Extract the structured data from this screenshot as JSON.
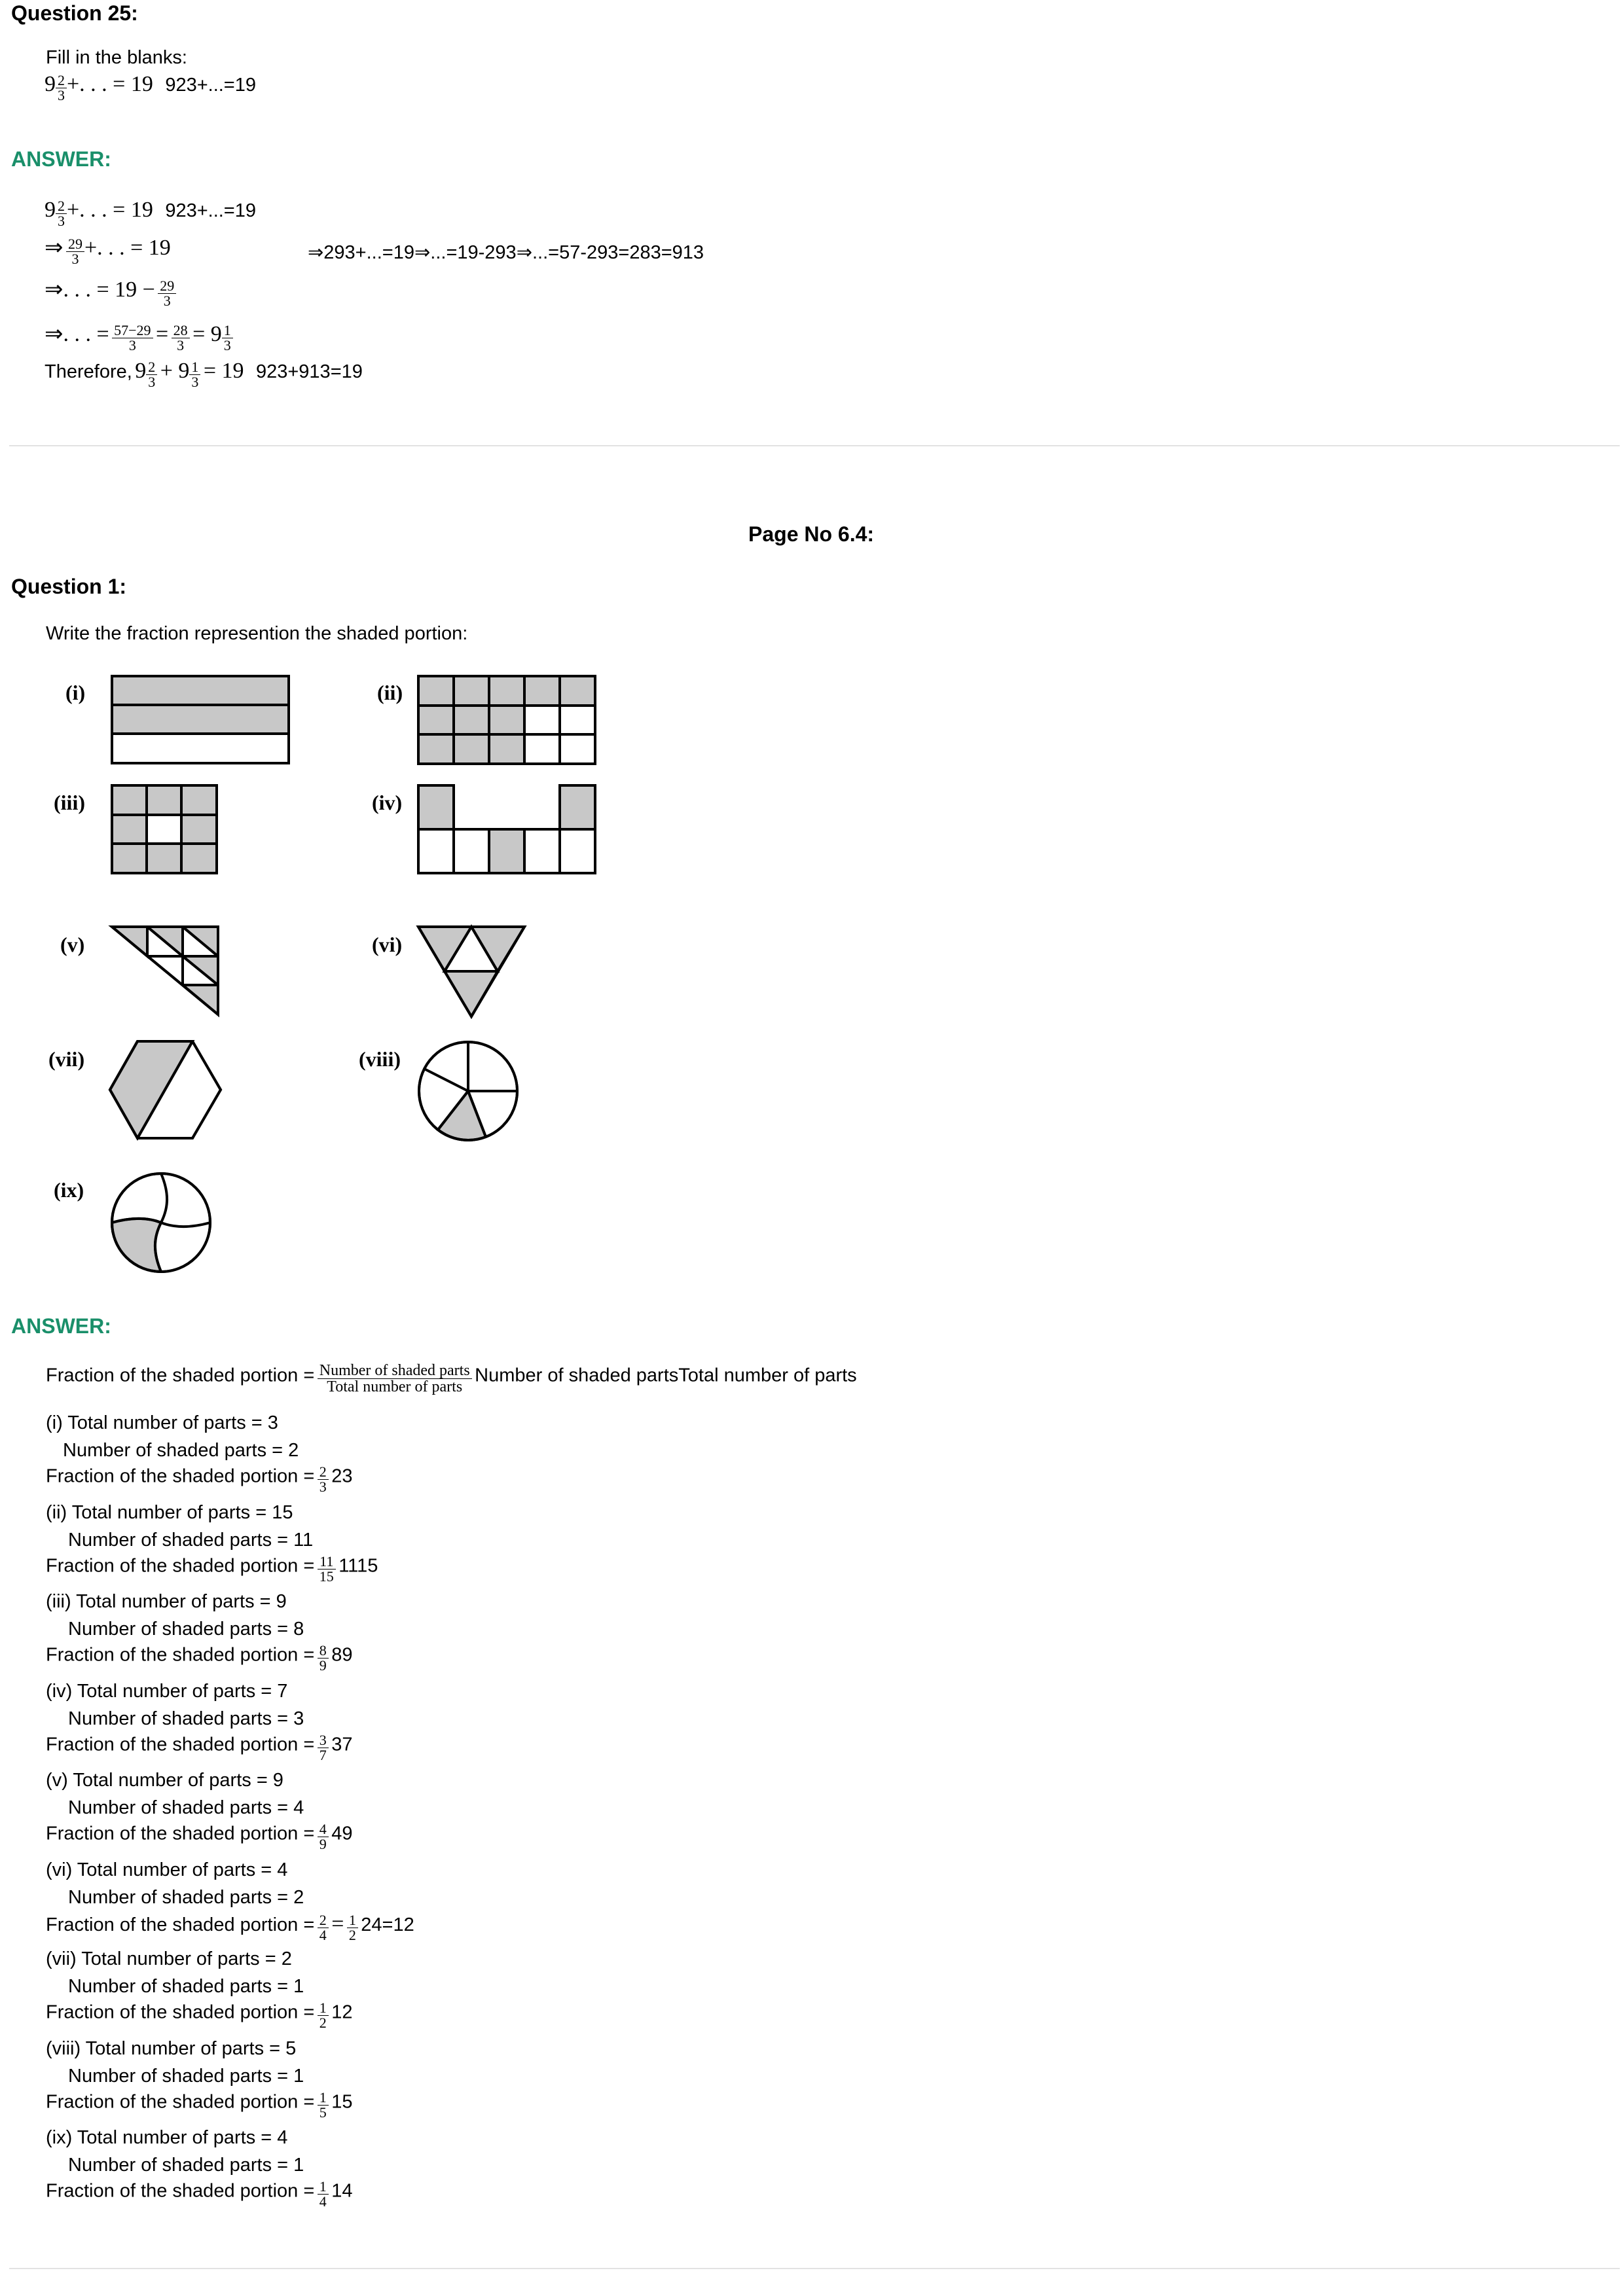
{
  "q25": {
    "title": "Question 25:",
    "instruction": "Fill in the blanks:",
    "expr_whole": "9",
    "expr_num": "2",
    "expr_den": "3",
    "expr_rest": "+. . . = 19",
    "plain": "923+...=19"
  },
  "ans25": {
    "title": "ANSWER:",
    "l1_whole": "9",
    "l1_num": "2",
    "l1_den": "3",
    "l1_rest": "+. . . = 19",
    "l1_plain": "923+...=19",
    "l2_arrow": "⇒",
    "l2_num": "29",
    "l2_den": "3",
    "l2_rest": "+. . . = 19",
    "l2_plain": "⇒293+...=19⇒...=19-293⇒...=57-293=283=913",
    "l3_text": "⇒. . . = 19 −",
    "l3_num": "29",
    "l3_den": "3",
    "l4_text": "⇒. . . =",
    "l4_num1": "57−29",
    "l4_den1": "3",
    "l4_eq": "=",
    "l4_num2": "28",
    "l4_den2": "3",
    "l4_eq2": "= 9",
    "l4_num3": "1",
    "l4_den3": "3",
    "l5_prefix": "Therefore,",
    "l5_w1": "9",
    "l5_n1": "2",
    "l5_d1": "3",
    "l5_plus": "+ 9",
    "l5_n2": "1",
    "l5_d2": "3",
    "l5_rest": "= 19",
    "l5_plain": "923+913=19"
  },
  "page_no": "Page No 6.4:",
  "q1": {
    "title": "Question 1:",
    "instruction": "Write the fraction represention the shaded portion:",
    "labels": [
      "(i)",
      "(ii)",
      "(iii)",
      "(iv)",
      "(v)",
      "(vi)",
      "(vii)",
      "(viii)",
      "(ix)"
    ]
  },
  "ans1": {
    "title": "ANSWER:",
    "formula_prefix": "Fraction of the shaded portion =",
    "formula_num": "Number  of  shaded  parts",
    "formula_den": "Total  number  of  parts",
    "formula_plain": "Number of shaded partsTotal number of parts",
    "frac_prefix": "Fraction of the shaded portion =",
    "items": [
      {
        "total": "(i) Total number of parts = 3",
        "shaded": "Number of shaded parts = 2",
        "num": "2",
        "den": "3",
        "plain": "23"
      },
      {
        "total": "(ii) Total number of parts = 15",
        "shaded": "Number of shaded parts = 11",
        "num": "11",
        "den": "15",
        "plain": "1115"
      },
      {
        "total": "(iii) Total number of parts = 9",
        "shaded": "Number of shaded parts = 8",
        "num": "8",
        "den": "9",
        "plain": "89"
      },
      {
        "total": "(iv) Total number of parts = 7",
        "shaded": "Number of shaded parts = 3",
        "num": "3",
        "den": "7",
        "plain": "37"
      },
      {
        "total": "(v) Total number of parts = 9",
        "shaded": "Number of shaded parts = 4",
        "num": "4",
        "den": "9",
        "plain": "49"
      },
      {
        "total": "(vi) Total number of parts = 4",
        "shaded": "Number of shaded parts = 2",
        "num": "2",
        "den": "4",
        "extra_eq": "=",
        "num2": "1",
        "den2": "2",
        "plain": "24=12"
      },
      {
        "total": "(vii) Total number of parts = 2",
        "shaded": "Number of shaded parts = 1",
        "num": "1",
        "den": "2",
        "plain": "12"
      },
      {
        "total": "(viii) Total number of parts = 5",
        "shaded": "Number of shaded parts = 1",
        "num": "1",
        "den": "5",
        "plain": "15"
      },
      {
        "total": "(ix) Total number of parts = 4",
        "shaded": "Number of shaded parts = 1",
        "num": "1",
        "den": "4",
        "plain": "14"
      }
    ]
  },
  "colors": {
    "answer": "#1a8f6a",
    "shade": "#c8c8c8",
    "rule": "#e2e2e2"
  }
}
